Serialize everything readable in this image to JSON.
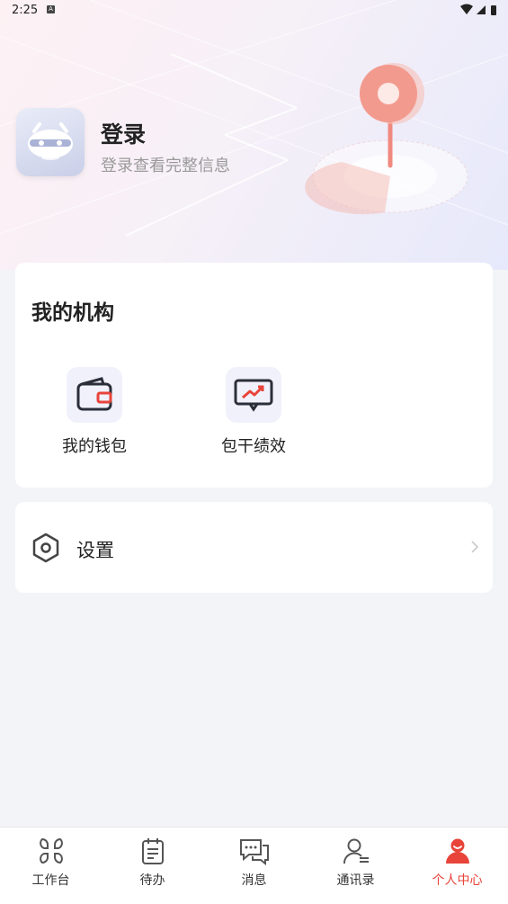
{
  "status_bar": {
    "time": "2:25",
    "notification_glyph": "A"
  },
  "profile": {
    "title": "登录",
    "subtitle": "登录查看完整信息",
    "avatar_icon": "robot-avatar-icon"
  },
  "org": {
    "title": "我的机构",
    "items": [
      {
        "label": "我的钱包",
        "icon": "wallet-icon"
      },
      {
        "label": "包干绩效",
        "icon": "performance-chart-icon"
      }
    ]
  },
  "settings": {
    "label": "设置",
    "icon": "settings-hexagon-icon"
  },
  "tabbar": {
    "items": [
      {
        "label": "工作台",
        "icon": "workbench-grid-icon",
        "active": false
      },
      {
        "label": "待办",
        "icon": "todo-clipboard-icon",
        "active": false
      },
      {
        "label": "消息",
        "icon": "message-icon",
        "active": false
      },
      {
        "label": "通讯录",
        "icon": "contacts-icon",
        "active": false
      },
      {
        "label": "个人中心",
        "icon": "profile-icon",
        "active": true
      }
    ]
  },
  "colors": {
    "accent": "#e8443a",
    "text": "#222222",
    "muted": "#9a9a9a",
    "icon_bg": "#f1f1fc"
  }
}
